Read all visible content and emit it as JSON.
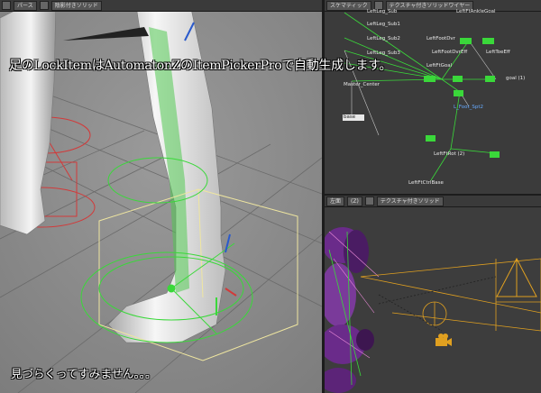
{
  "left_viewport": {
    "view_mode": "パース",
    "shading_mode": "陰影付きソリッド"
  },
  "schematic": {
    "view_label": "スケマティック",
    "shading_label": "テクスチャ付きソリッドワイヤー",
    "nodes": [
      {
        "label": "LeftLeg_Sub",
        "style": "w"
      },
      {
        "label": "LeftFtAnkleGoal",
        "style": "w"
      },
      {
        "label": "LeftLeg_Sub1",
        "style": "w"
      },
      {
        "label": "LeftLeg_Sub2",
        "style": "w"
      },
      {
        "label": "LeftFootDvr",
        "style": "w"
      },
      {
        "label": "LeftLeg_Sub3",
        "style": "w"
      },
      {
        "label": "LeftFootDvrEff",
        "style": "w"
      },
      {
        "label": "LeftToeEff",
        "style": "w"
      },
      {
        "label": "LeftFtGoal",
        "style": "w"
      },
      {
        "label": "Master_Center",
        "style": "w"
      },
      {
        "label": "base",
        "style": "box"
      },
      {
        "label": "L_Foot_Spt2",
        "style": "b"
      },
      {
        "label": "LeftFtRot (2)",
        "style": "w"
      },
      {
        "label": "LeftFtCtrlBase",
        "style": "w"
      },
      {
        "label": "goal (1)",
        "style": "w"
      }
    ]
  },
  "camera_viewport": {
    "view_label": "左面",
    "layer_label": "(Z)",
    "shading_label": "テクスチャ付きソリッド"
  },
  "caption_top": "足のLockItemはAutomatonZのItemPickerProで自動生成します。",
  "caption_bottom": "見づらくってすみません。。。"
}
